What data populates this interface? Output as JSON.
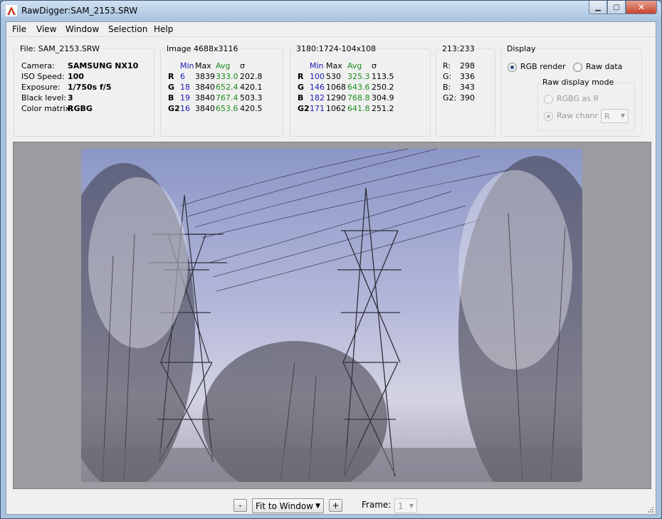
{
  "window": {
    "title": "RawDigger:SAM_2153.SRW"
  },
  "menu": [
    "File",
    "View",
    "Window",
    "Selection",
    "Help"
  ],
  "file_panel": {
    "title": "File: SAM_2153.SRW",
    "rows": [
      {
        "label": "Camera:",
        "value": "SAMSUNG NX10"
      },
      {
        "label": "ISO Speed:",
        "value": "100"
      },
      {
        "label": "Exposure:",
        "value": "1/750s f/5"
      },
      {
        "label": "Black level:",
        "value": "3"
      },
      {
        "label": "Color matrix:",
        "value": "RGBG"
      }
    ]
  },
  "image_panel": {
    "title": "Image 4688x3116",
    "headers": [
      "Min",
      "Max",
      "Avg",
      "σ"
    ],
    "rows": [
      {
        "ch": "R",
        "min": "6",
        "max": "3839",
        "avg": "333.0",
        "sd": "202.8"
      },
      {
        "ch": "G",
        "min": "18",
        "max": "3840",
        "avg": "652.4",
        "sd": "420.1"
      },
      {
        "ch": "B",
        "min": "19",
        "max": "3840",
        "avg": "767.4",
        "sd": "503.3"
      },
      {
        "ch": "G2",
        "min": "16",
        "max": "3840",
        "avg": "653.6",
        "sd": "420.5"
      }
    ]
  },
  "selection_panel": {
    "title": "3180:1724-104x108",
    "headers": [
      "Min",
      "Max",
      "Avg",
      "σ"
    ],
    "rows": [
      {
        "ch": "R",
        "min": "100",
        "max": "530",
        "avg": "325.3",
        "sd": "113.5"
      },
      {
        "ch": "G",
        "min": "146",
        "max": "1068",
        "avg": "643.6",
        "sd": "250.2"
      },
      {
        "ch": "B",
        "min": "182",
        "max": "1290",
        "avg": "768.8",
        "sd": "304.9"
      },
      {
        "ch": "G2",
        "min": "171",
        "max": "1062",
        "avg": "641.8",
        "sd": "251.2"
      }
    ]
  },
  "pixel_panel": {
    "title": "213:233",
    "rows": [
      {
        "label": "R:",
        "value": "298"
      },
      {
        "label": "G:",
        "value": "336"
      },
      {
        "label": "B:",
        "value": "343"
      },
      {
        "label": "G2:",
        "value": "390"
      }
    ]
  },
  "display_panel": {
    "title": "Display",
    "rgb_render": "RGB render",
    "raw_data": "Raw data",
    "mode_title": "Raw display mode",
    "rgbg_as_rg": "RGBG as RG",
    "raw_channel": "Raw channel",
    "channel_value": "R"
  },
  "bottom": {
    "zoom_minus": "-",
    "zoom_value": "Fit to Window",
    "zoom_plus": "+",
    "frame_label": "Frame:",
    "frame_value": "1"
  },
  "colors": {
    "min_color": "#1a1ab4",
    "avg_color": "#1c8c1c"
  }
}
